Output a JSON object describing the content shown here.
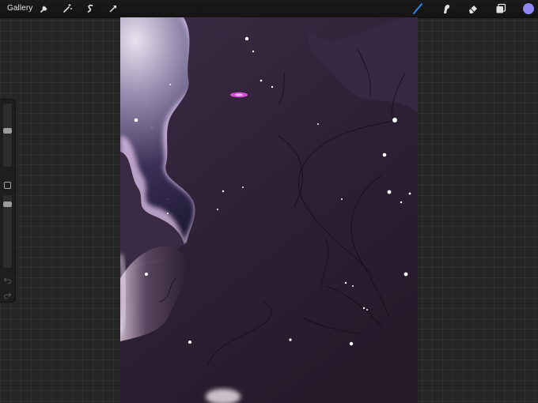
{
  "topbar": {
    "gallery_label": "Gallery",
    "left_tools": [
      "wrench-icon",
      "magic-wand-icon",
      "selection-icon",
      "transform-arrow-icon"
    ],
    "right_tools": [
      "brush-icon",
      "smudge-icon",
      "eraser-icon",
      "layers-icon"
    ],
    "active_tool": "brush-icon",
    "current_color": "#8f86f2"
  },
  "sidebar": {
    "brush_size_level": 0.72,
    "opacity_level": 0.95,
    "buttons": [
      "modify-button",
      "undo-arrow-icon",
      "redo-arrow-icon"
    ]
  },
  "canvas": {
    "artwork": "purple-creature-silhouette-on-starry-sky"
  }
}
